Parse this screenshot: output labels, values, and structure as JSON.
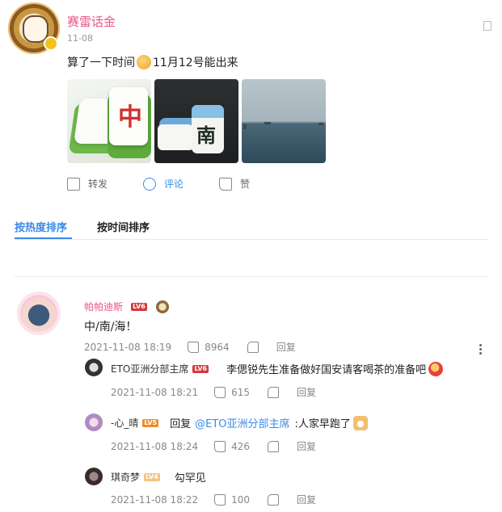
{
  "post": {
    "username": "赛雷话金",
    "date": "11-08",
    "text_before": "算了一下时间",
    "text_after": "11月12号能出来",
    "actions": {
      "share": "转发",
      "comment": "评论",
      "like": "赞"
    }
  },
  "tabs": {
    "hot": "按热度排序",
    "time": "按时间排序"
  },
  "comments": [
    {
      "name": "帕帕迪斯",
      "level": "LV6",
      "text": "中/南/海！",
      "time": "2021-11-08 18:19",
      "likes": "8964",
      "reply_label": "回复",
      "replies": [
        {
          "name": "ETO亚洲分部主席",
          "level": "LV6",
          "text": "李偲锐先生准备做好国安请客喝茶的准备吧",
          "time": "2021-11-08 18:21",
          "likes": "615",
          "reply_label": "回复"
        },
        {
          "name": "-心_晴",
          "level": "LV5",
          "reply_prefix": "回复",
          "mention": "@ETO亚洲分部主席",
          "text": ":人家早跑了",
          "time": "2021-11-08 18:24",
          "likes": "426",
          "reply_label": "回复"
        },
        {
          "name": "琪奇梦",
          "level": "LV4",
          "text": "勾罕见",
          "time": "2021-11-08 18:22",
          "likes": "100",
          "reply_label": "回复"
        }
      ]
    }
  ]
}
